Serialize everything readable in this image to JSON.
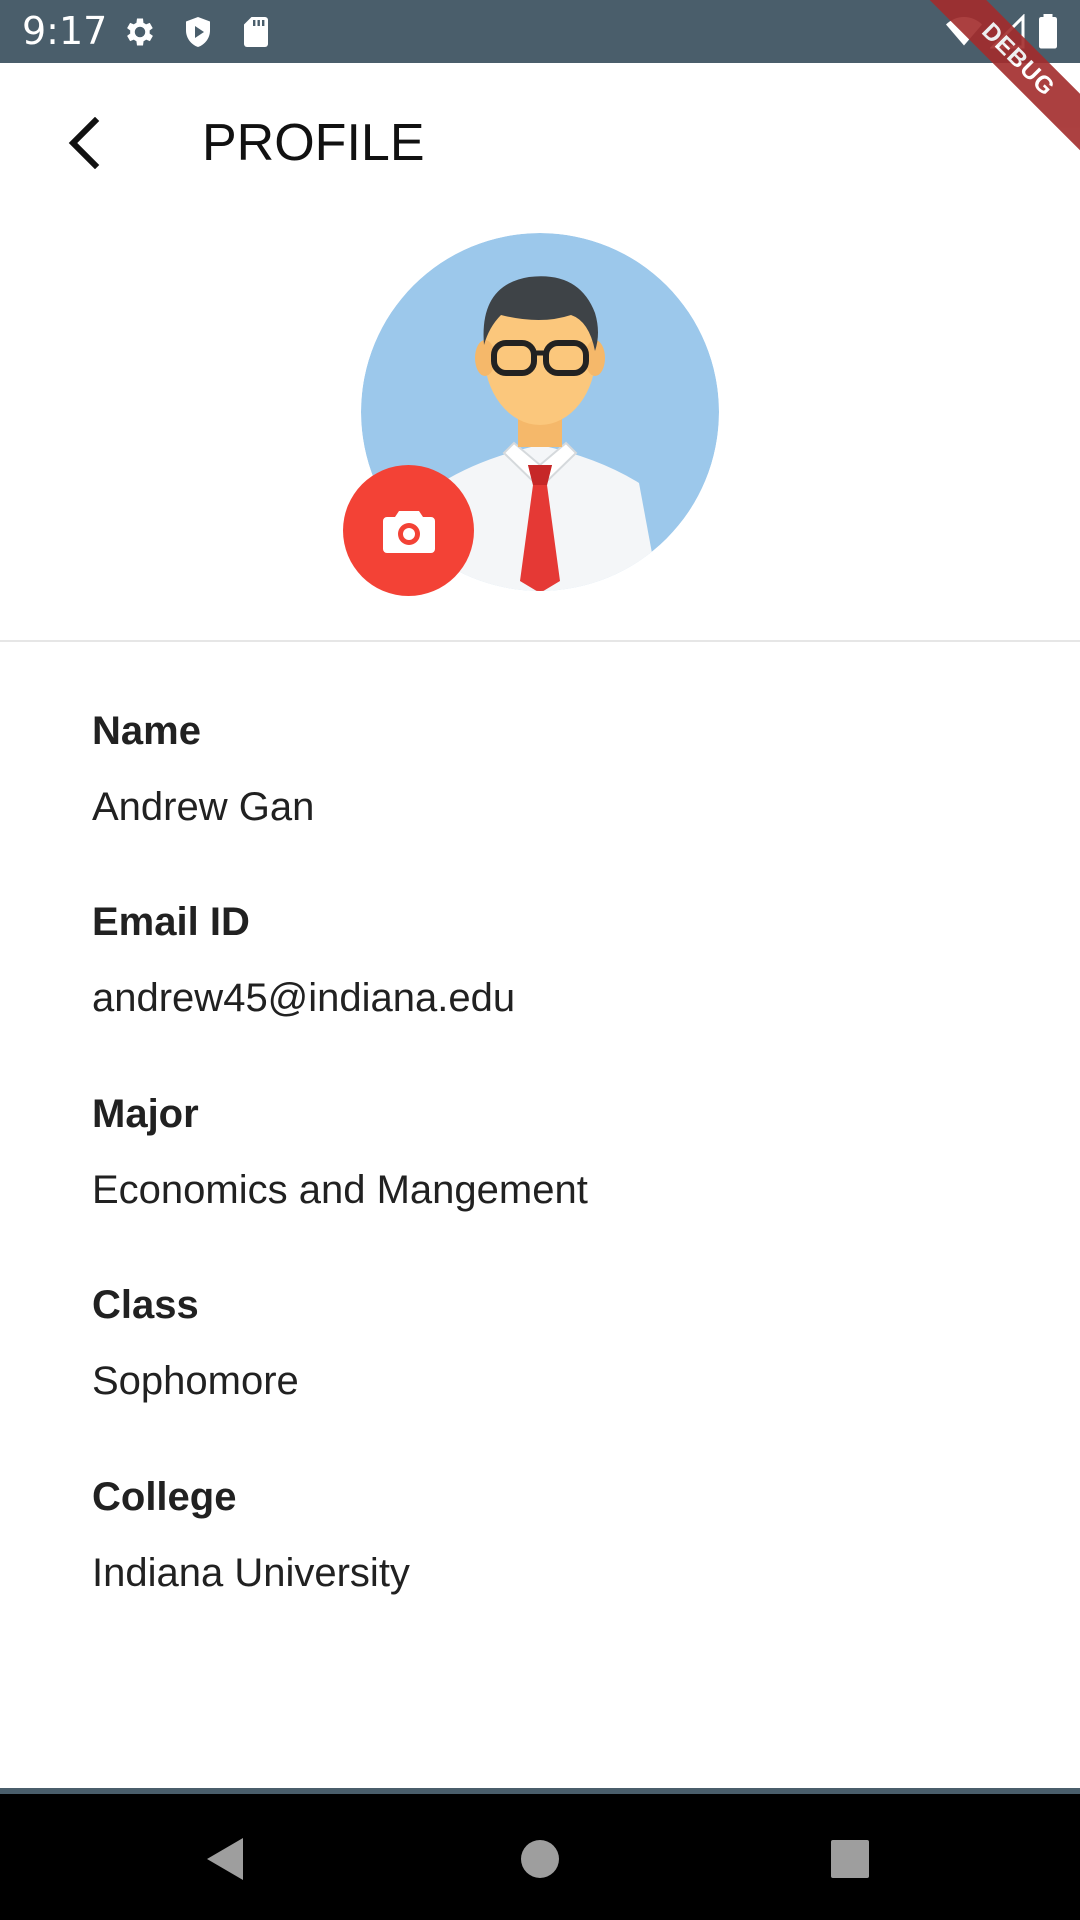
{
  "status_bar": {
    "time": "9:17",
    "left_icons": [
      "gear-icon",
      "shield-icon",
      "sd-card-icon"
    ],
    "right_icons": [
      "wifi-icon",
      "signal-icon",
      "battery-icon"
    ]
  },
  "debug_banner": "DEBUG",
  "app_bar": {
    "title": "PROFILE",
    "back_icon": "chevron-left-icon"
  },
  "avatar": {
    "background_color": "#9cc8eb",
    "camera_button_color": "#f34236",
    "camera_icon": "camera-icon"
  },
  "fields": [
    {
      "label": "Name",
      "value": "Andrew Gan"
    },
    {
      "label": "Email ID",
      "value": "andrew45@indiana.edu"
    },
    {
      "label": "Major",
      "value": "Economics and Mangement"
    },
    {
      "label": "Class",
      "value": "Sophomore"
    },
    {
      "label": "College",
      "value": "Indiana University"
    }
  ],
  "nav_bar": {
    "buttons": [
      "back-triangle-icon",
      "home-circle-icon",
      "recents-square-icon"
    ]
  }
}
